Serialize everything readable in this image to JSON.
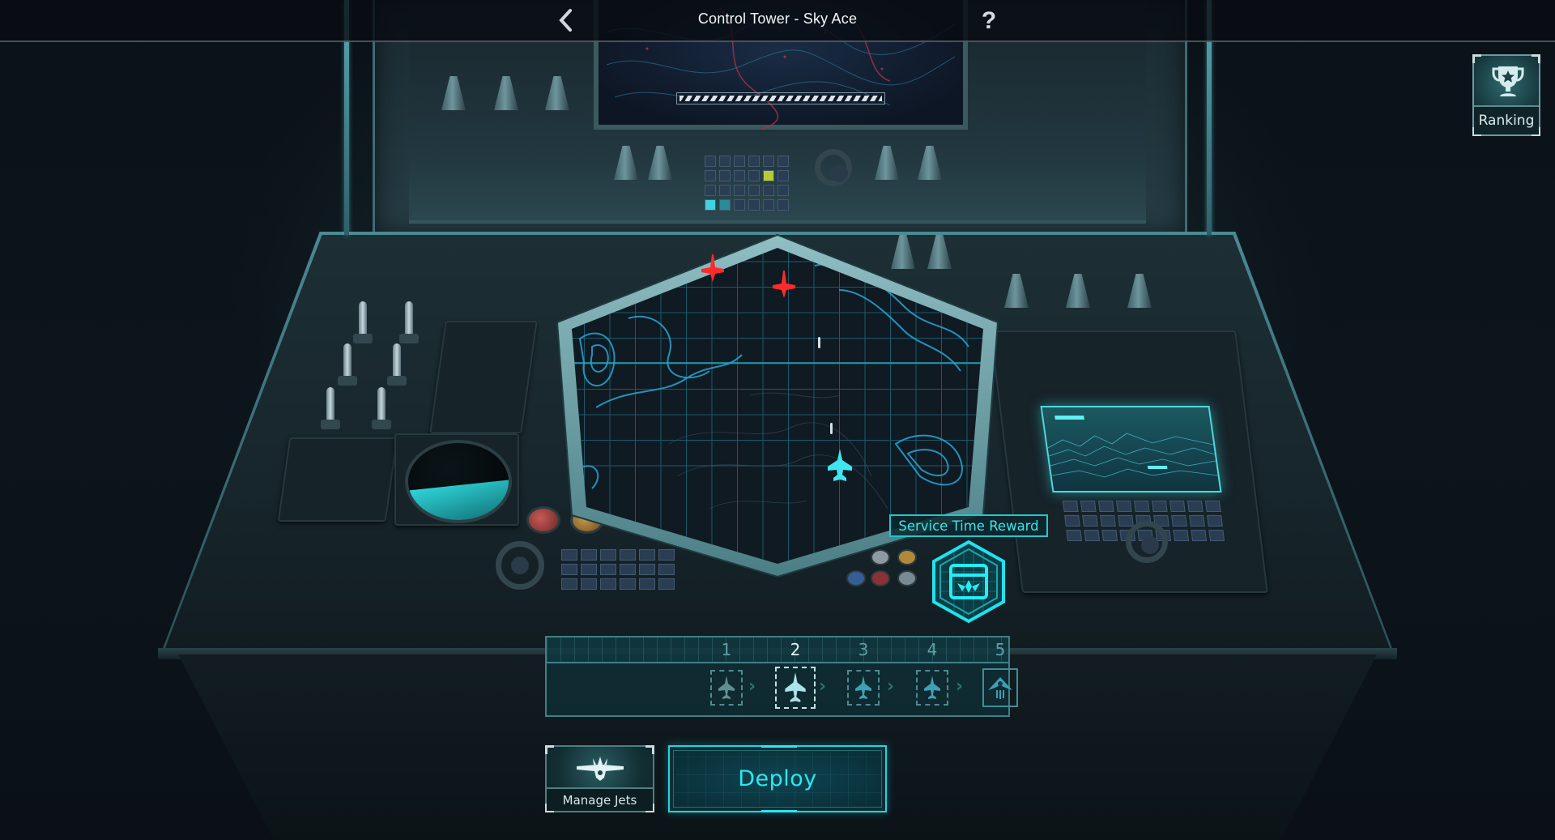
{
  "topbar": {
    "title": "Control Tower - Sky Ace",
    "back_icon": "chevron-left-icon",
    "help_label": "?"
  },
  "ranking": {
    "label": "Ranking",
    "icon": "trophy-star-icon"
  },
  "reward": {
    "label": "Service Time Reward",
    "icon": "reward-chest-hex-icon"
  },
  "radar": {
    "enemies": [
      {
        "type": "enemy-jet",
        "color": "#ff2a2a"
      },
      {
        "type": "enemy-jet",
        "color": "#ff2a2a"
      }
    ],
    "player": {
      "type": "player-jet",
      "color": "#3fe6f2"
    }
  },
  "stages": {
    "current": 2,
    "items": [
      {
        "number": "1",
        "icon": "jet-icon",
        "state": "cleared"
      },
      {
        "number": "2",
        "icon": "jet-icon",
        "state": "current"
      },
      {
        "number": "3",
        "icon": "jet-icon",
        "state": "locked"
      },
      {
        "number": "4",
        "icon": "jet-icon",
        "state": "locked"
      },
      {
        "number": "5",
        "icon": "boss-bomber-icon",
        "state": "boss"
      }
    ]
  },
  "actions": {
    "manage_label": "Manage Jets",
    "deploy_label": "Deploy"
  },
  "colors": {
    "accent": "#2de6f0",
    "enemy": "#ff2a2a",
    "panel_border": "#3f7f86"
  }
}
